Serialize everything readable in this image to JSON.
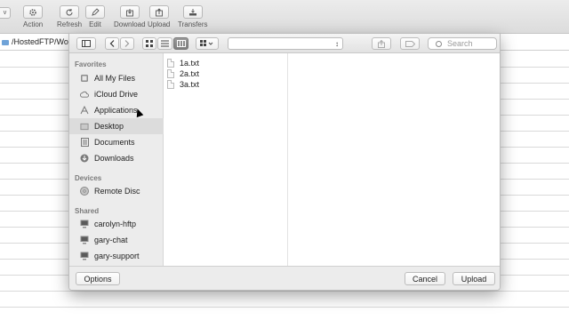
{
  "toolbar": {
    "left_stub": "v",
    "items": [
      {
        "label": "Action",
        "icon": "gear-icon"
      },
      {
        "label": "Refresh",
        "icon": "refresh-icon"
      },
      {
        "label": "Edit",
        "icon": "edit-icon"
      },
      {
        "label": "Download",
        "icon": "download-icon"
      },
      {
        "label": "Upload",
        "icon": "upload-icon"
      },
      {
        "label": "Transfers",
        "icon": "transfers-icon"
      }
    ]
  },
  "pathbar": {
    "path": "/HostedFTP/Wo"
  },
  "dialog": {
    "toolbar": {
      "path_popup_value": "",
      "search_placeholder": "Search"
    },
    "sidebar": {
      "favorites_header": "Favorites",
      "favorites": [
        {
          "label": "All My Files",
          "icon": "all-files-icon"
        },
        {
          "label": "iCloud Drive",
          "icon": "cloud-icon"
        },
        {
          "label": "Applications",
          "icon": "applications-icon"
        },
        {
          "label": "Desktop",
          "icon": "desktop-icon",
          "selected": true
        },
        {
          "label": "Documents",
          "icon": "documents-icon"
        },
        {
          "label": "Downloads",
          "icon": "downloads-icon"
        }
      ],
      "devices_header": "Devices",
      "devices": [
        {
          "label": "Remote Disc",
          "icon": "disc-icon"
        }
      ],
      "shared_header": "Shared",
      "shared": [
        {
          "label": "carolyn-hftp",
          "icon": "computer-icon"
        },
        {
          "label": "gary-chat",
          "icon": "computer-icon"
        },
        {
          "label": "gary-support",
          "icon": "computer-icon"
        }
      ]
    },
    "files": [
      "1a.txt",
      "2a.txt",
      "3a.txt"
    ],
    "footer": {
      "options_label": "Options",
      "cancel_label": "Cancel",
      "upload_label": "Upload"
    }
  }
}
